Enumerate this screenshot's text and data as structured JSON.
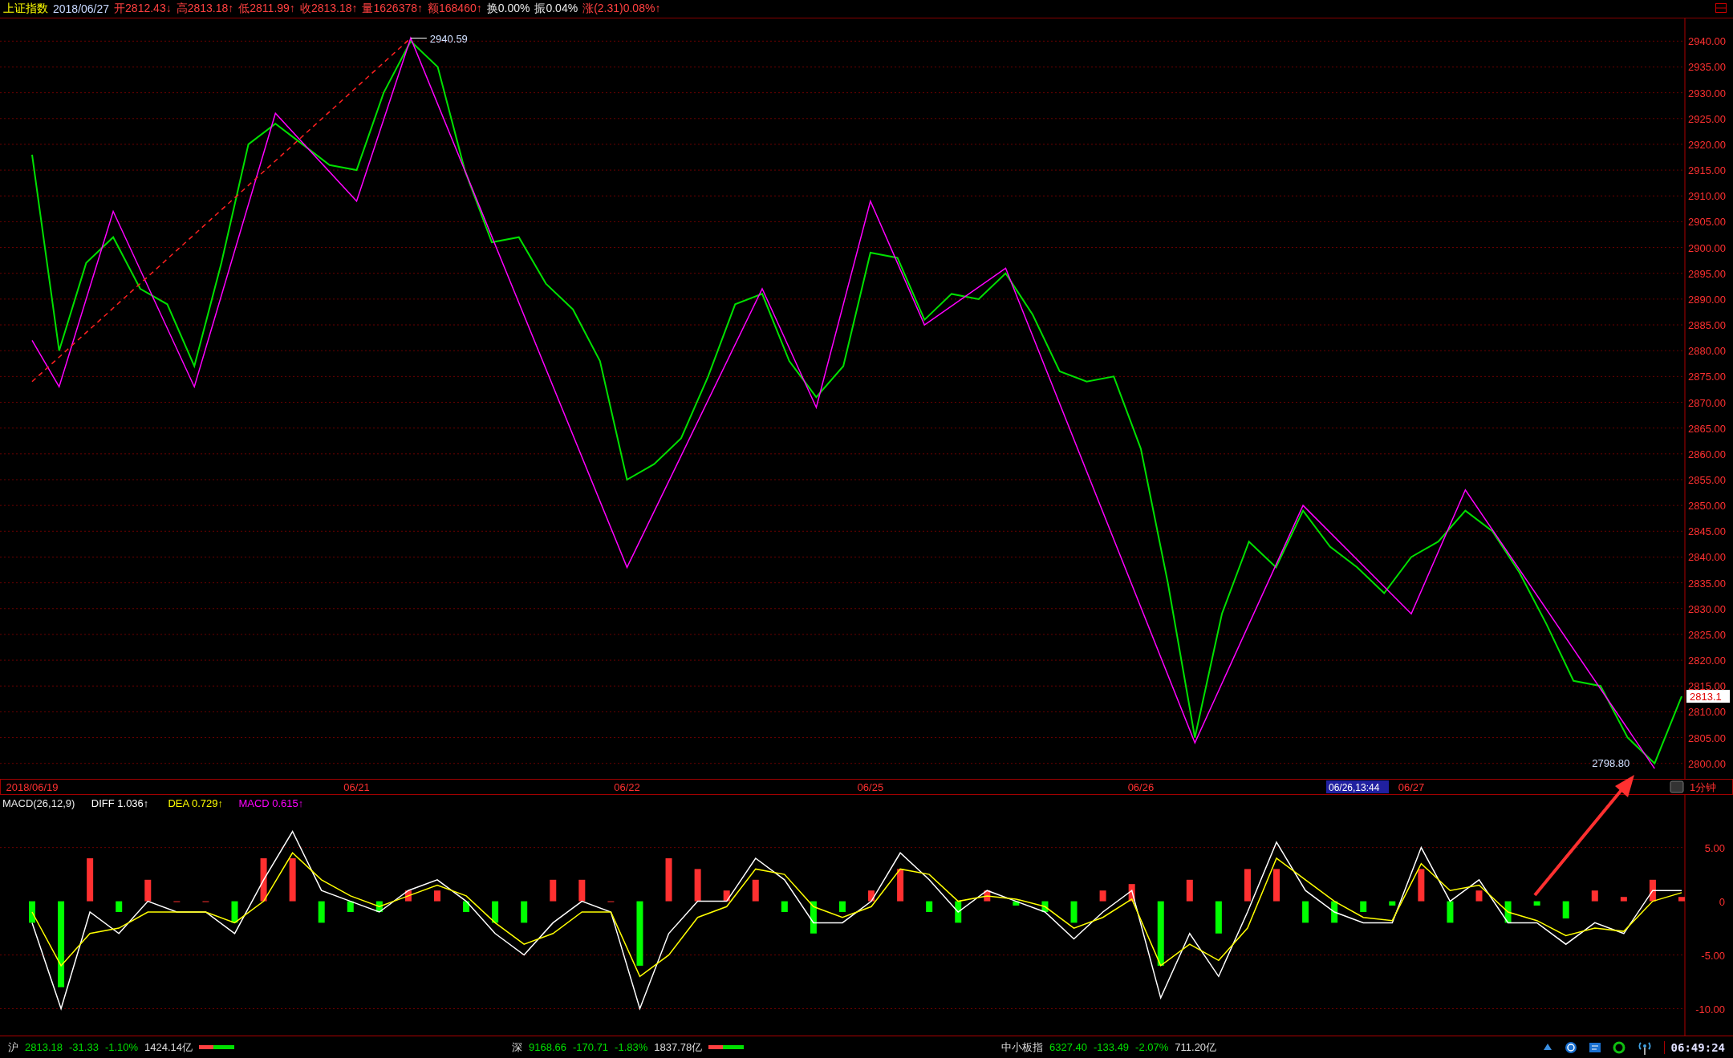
{
  "header": {
    "items": [
      {
        "text": "上证指数",
        "color": "#ffff00"
      },
      {
        "text": "2018/06/27",
        "color": "#c8d8ff"
      },
      {
        "text": "开2812.43↓",
        "color": "#ff4040"
      },
      {
        "text": "高2813.18↑",
        "color": "#ff4040"
      },
      {
        "text": "低2811.99↑",
        "color": "#ff4040"
      },
      {
        "text": "收2813.18↑",
        "color": "#ff4040"
      },
      {
        "text": "量1626378↑",
        "color": "#ff4040"
      },
      {
        "text": "额168460↑",
        "color": "#ff4040"
      },
      {
        "text": "换0.00%",
        "color": "#e8e8e8"
      },
      {
        "text": "振0.04%",
        "color": "#e8e8e8"
      },
      {
        "text": "涨(2.31)0.08%↑",
        "color": "#ff4040"
      }
    ]
  },
  "price_chart": {
    "high_label": "2940.59",
    "low_label": "2798.80",
    "current_price": "2813.1",
    "chart_data": {
      "type": "line",
      "grid": true,
      "ylim": [
        2797,
        2944.4
      ],
      "categories": [
        "2018/06/19",
        null,
        null,
        null,
        null,
        null,
        null,
        null,
        null,
        null,
        null,
        null,
        "06/21",
        null,
        null,
        null,
        null,
        null,
        null,
        null,
        null,
        null,
        "06/22",
        null,
        null,
        null,
        null,
        null,
        null,
        null,
        null,
        "06/25",
        null,
        null,
        null,
        null,
        null,
        null,
        null,
        null,
        null,
        "06/26",
        null,
        null,
        null,
        null,
        null,
        null,
        null,
        null,
        null,
        "06/27",
        null,
        null,
        null,
        null,
        null,
        null,
        null,
        null,
        null,
        null
      ],
      "series": [
        {
          "color": "#00e000",
          "values": [
            2918,
            2880,
            2897,
            2902,
            2892,
            2889,
            2877,
            2897,
            2920,
            2924,
            2920,
            2916,
            2915,
            2930,
            2940,
            2935,
            2915,
            2901,
            2902,
            2893,
            2888,
            2878,
            2855,
            2858,
            2863,
            2875,
            2889,
            2891,
            2878,
            2871,
            2877,
            2899,
            2898,
            2886,
            2891,
            2890,
            2895,
            2887,
            2876,
            2874,
            2875,
            2861,
            2835,
            2805,
            2829,
            2843,
            2838,
            2849,
            2842,
            2838,
            2833,
            2840,
            2843,
            2849,
            2845,
            2837,
            2827,
            2816,
            2815,
            2805,
            2800,
            2813
          ]
        },
        {
          "color": "#ff00ff",
          "values": [
            2882,
            2873,
            null,
            2907,
            null,
            null,
            2873,
            null,
            null,
            2926,
            null,
            null,
            2909,
            null,
            2940.59,
            null,
            null,
            null,
            null,
            null,
            null,
            null,
            2838,
            null,
            null,
            null,
            null,
            2892,
            null,
            2869,
            null,
            2909,
            null,
            2885,
            null,
            null,
            2896,
            null,
            null,
            null,
            null,
            null,
            null,
            2804,
            null,
            null,
            null,
            2850,
            null,
            null,
            null,
            2829,
            null,
            2853,
            null,
            null,
            null,
            null,
            null,
            null,
            2799,
            null
          ]
        },
        {
          "color": "#ff2020",
          "line_style": "dashed",
          "values": [
            2874,
            null,
            null,
            null,
            null,
            null,
            null,
            null,
            null,
            null,
            null,
            null,
            null,
            null,
            2940.59,
            null,
            null,
            null,
            null,
            null,
            null,
            null,
            null,
            null,
            null,
            null,
            null,
            null,
            null,
            null,
            null,
            null,
            null,
            null,
            null,
            null,
            null,
            null,
            null,
            null,
            null,
            null,
            null,
            null,
            null,
            null,
            null,
            null,
            null,
            null,
            null,
            null,
            null,
            null,
            null,
            null,
            null,
            null,
            null,
            null,
            null,
            null
          ]
        }
      ],
      "yticks": [
        {
          "value": 2800,
          "label": "2800.00"
        },
        {
          "value": 2805,
          "label": "2805.00"
        },
        {
          "value": 2810,
          "label": "2810.00"
        },
        {
          "value": 2815,
          "label": "2815.00"
        },
        {
          "value": 2820,
          "label": "2820.00"
        },
        {
          "value": 2825,
          "label": "2825.00"
        },
        {
          "value": 2830,
          "label": "2830.00"
        },
        {
          "value": 2835,
          "label": "2835.00"
        },
        {
          "value": 2840,
          "label": "2840.00"
        },
        {
          "value": 2845,
          "label": "2845.00"
        },
        {
          "value": 2850,
          "label": "2850.00"
        },
        {
          "value": 2855,
          "label": "2855.00"
        },
        {
          "value": 2860,
          "label": "2860.00"
        },
        {
          "value": 2865,
          "label": "2865.00"
        },
        {
          "value": 2870,
          "label": "2870.00"
        },
        {
          "value": 2875,
          "label": "2875.00"
        },
        {
          "value": 2880,
          "label": "2880.00"
        },
        {
          "value": 2885,
          "label": "2885.00"
        },
        {
          "value": 2890,
          "label": "2890.00"
        },
        {
          "value": 2895,
          "label": "2895.00"
        },
        {
          "value": 2900,
          "label": "2900.00"
        },
        {
          "value": 2905,
          "label": "2905.00"
        },
        {
          "value": 2910,
          "label": "2910.00"
        },
        {
          "value": 2915,
          "label": "2915.00"
        },
        {
          "value": 2920,
          "label": "2920.00"
        },
        {
          "value": 2925,
          "label": "2925.00"
        },
        {
          "value": 2930,
          "label": "2930.00"
        },
        {
          "value": 2935,
          "label": "2935.00"
        },
        {
          "value": 2940,
          "label": "2940.00"
        }
      ]
    }
  },
  "date_axis": {
    "cursor_label": "06/26,13:44",
    "period": "1分钟"
  },
  "macd": {
    "legend": [
      {
        "text": "MACD(26,12,9)",
        "color": "#e8e8e8"
      },
      {
        "text": "DIFF 1.036↑",
        "color": "#ffffff"
      },
      {
        "text": "DEA 0.729↑",
        "color": "#ffff00"
      },
      {
        "text": "MACD 0.615↑",
        "color": "#ff00ff"
      }
    ],
    "chart_data": {
      "type": "line",
      "grid": true,
      "ylim": [
        -12.5,
        9.9
      ],
      "series": [
        {
          "color": "#ffffff",
          "values": [
            -2,
            -10,
            -1,
            -3,
            0,
            -1,
            -1,
            -3,
            2,
            6.5,
            1,
            0,
            -1,
            1,
            2,
            0,
            -3,
            -5,
            -2,
            0,
            -1,
            -10,
            -3,
            0,
            0,
            4,
            2,
            -2,
            -2,
            0,
            4.5,
            2,
            -1,
            1,
            0,
            -1,
            -3.5,
            -1,
            1,
            -9,
            -3,
            -7,
            -1,
            5.5,
            1,
            -1,
            -2,
            -2,
            5,
            0,
            2,
            -2,
            -2,
            -4,
            -2,
            -3,
            1,
            1
          ]
        },
        {
          "color": "#ffff00",
          "values": [
            -1,
            -6,
            -3,
            -2.5,
            -1,
            -1,
            -1,
            -2,
            0,
            4.5,
            2,
            0.5,
            -0.5,
            0.5,
            1.5,
            0.5,
            -2,
            -4,
            -3,
            -1,
            -1,
            -7,
            -5,
            -1.5,
            -0.5,
            3,
            2.5,
            -0.5,
            -1.5,
            -0.5,
            3,
            2.5,
            0,
            0.5,
            0.2,
            -0.5,
            -2.5,
            -1.5,
            0.2,
            -6,
            -4,
            -5.5,
            -2.5,
            4,
            2,
            0,
            -1.5,
            -1.8,
            3.5,
            1,
            1.5,
            -1,
            -1.8,
            -3.2,
            -2.5,
            -2.8,
            0,
            0.8
          ]
        },
        {
          "type": "bar",
          "color": "#ff3030",
          "values": [
            null,
            null,
            4,
            null,
            2,
            0,
            0,
            null,
            4,
            4,
            null,
            null,
            null,
            1,
            1,
            null,
            null,
            null,
            2,
            2,
            0,
            null,
            4,
            3,
            1,
            2,
            null,
            null,
            null,
            1,
            3,
            null,
            null,
            1,
            null,
            null,
            null,
            1,
            1.6,
            null,
            2,
            null,
            3,
            3,
            null,
            null,
            null,
            null,
            3,
            null,
            1,
            null,
            null,
            null,
            1,
            0.4,
            2,
            0.4
          ]
        },
        {
          "type": "bar",
          "color": "#00ff00",
          "values": [
            -2,
            -8,
            null,
            -1,
            null,
            null,
            null,
            -2,
            null,
            null,
            -2,
            -1,
            -1,
            null,
            null,
            -1,
            -2,
            -2,
            null,
            null,
            null,
            -6,
            null,
            null,
            null,
            null,
            -1,
            -3,
            -1,
            null,
            null,
            -1,
            -2,
            null,
            -0.4,
            -1,
            -2,
            null,
            null,
            -6,
            null,
            -3,
            null,
            null,
            -2,
            -2,
            -1,
            -0.4,
            null,
            -2,
            null,
            -2,
            -0.4,
            -1.6,
            null,
            null,
            null,
            null
          ]
        }
      ],
      "yticks": [
        {
          "value": 5,
          "label": "5.00"
        },
        {
          "value": 0,
          "label": "0"
        },
        {
          "value": -5,
          "label": "-5.00"
        },
        {
          "value": -10,
          "label": "-10.00"
        }
      ]
    }
  },
  "status_bar": {
    "markets": [
      {
        "name": "沪",
        "price": "2813.18",
        "change": "-31.33",
        "percent": "-1.10%",
        "amount": "1424.14亿",
        "breadth": {
          "level": 0.4
        }
      },
      {
        "name": "深",
        "price": "9168.66",
        "change": "-170.71",
        "percent": "-1.83%",
        "amount": "1837.78亿",
        "breadth": {
          "level": 0.4
        }
      },
      {
        "name": "中小板指",
        "price": "6327.40",
        "change": "-133.49",
        "percent": "-2.07%",
        "amount": "711.20亿"
      }
    ],
    "clock": "06:49:24"
  }
}
